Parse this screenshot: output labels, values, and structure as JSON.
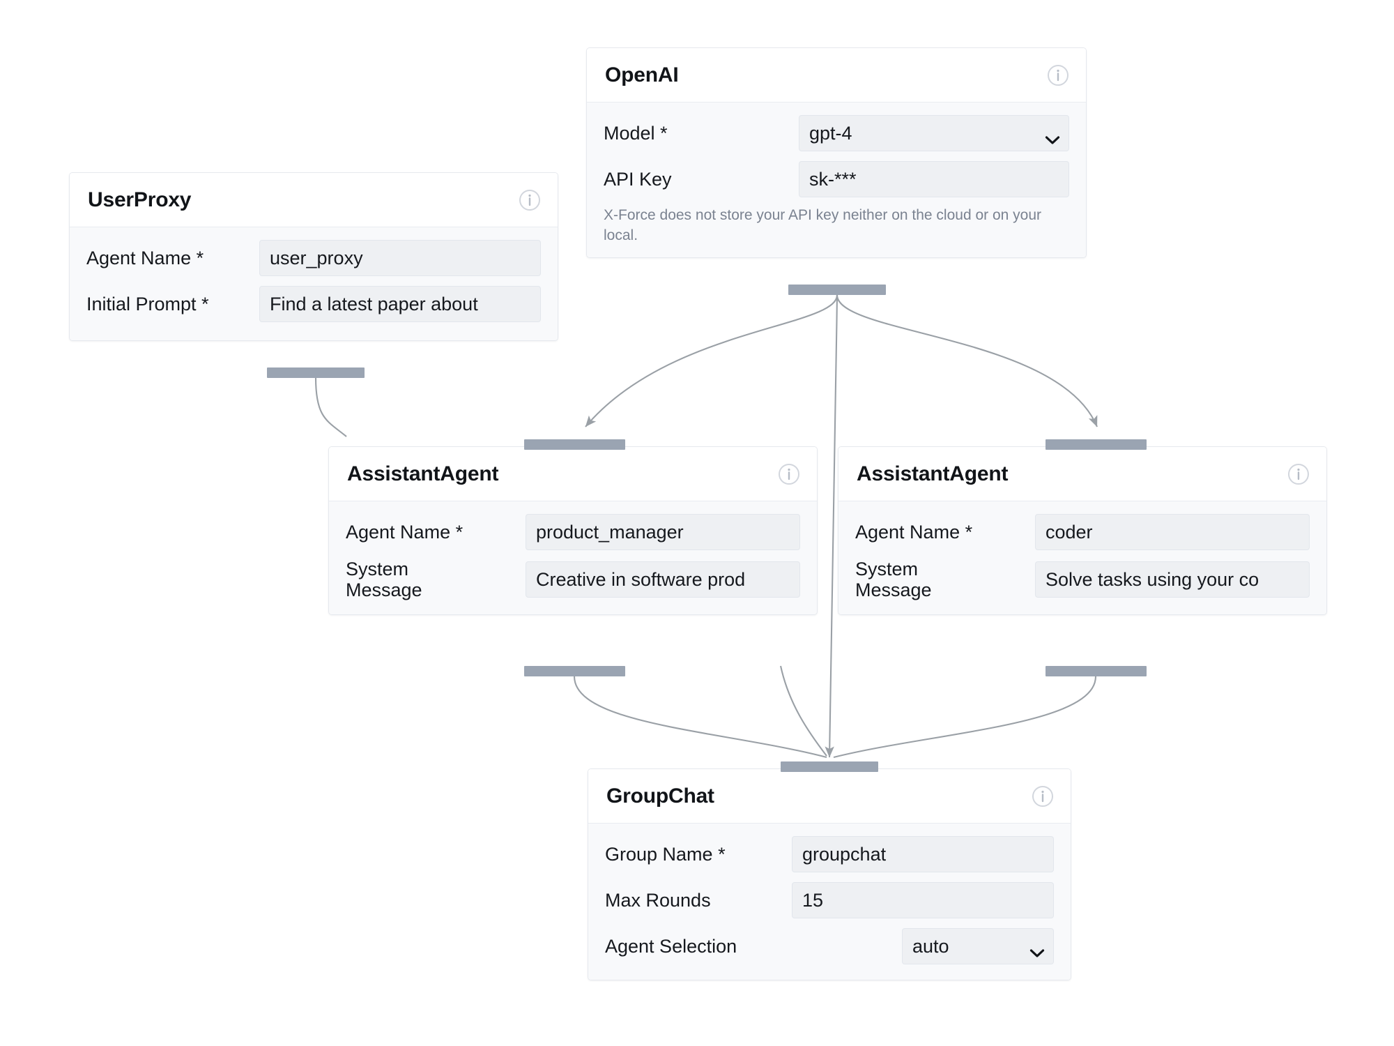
{
  "canvas": {
    "background": "#ffffff",
    "handle_color": "#9aa4b2",
    "edge_color": "#9aa0a6",
    "field_background": "#eef0f3",
    "node_body_background": "#f8f9fb",
    "node_border": "#e6e9ee"
  },
  "nodes": {
    "userproxy": {
      "title": "UserProxy",
      "info_icon": "info-circle-icon",
      "fields": [
        {
          "label": "Agent Name *",
          "value": "user_proxy",
          "type": "text"
        },
        {
          "label": "Initial Prompt *",
          "value": "Find a latest paper about",
          "type": "text"
        }
      ]
    },
    "openai": {
      "title": "OpenAI",
      "info_icon": "info-circle-icon",
      "fields": [
        {
          "label": "Model *",
          "value": "gpt-4",
          "type": "select"
        },
        {
          "label": "API Key",
          "value": "sk-***",
          "type": "text"
        }
      ],
      "hint": "X-Force does not store your API key neither on the cloud or on your local."
    },
    "assistant_1": {
      "title": "AssistantAgent",
      "info_icon": "info-circle-icon",
      "fields": [
        {
          "label": "Agent Name *",
          "value": "product_manager",
          "type": "text"
        },
        {
          "label": "System\nMessage",
          "value": "Creative in software prod",
          "type": "text"
        }
      ]
    },
    "assistant_2": {
      "title": "AssistantAgent",
      "info_icon": "info-circle-icon",
      "fields": [
        {
          "label": "Agent Name *",
          "value": "coder",
          "type": "text"
        },
        {
          "label": "System\nMessage",
          "value": "Solve tasks using your co",
          "type": "text"
        }
      ]
    },
    "groupchat": {
      "title": "GroupChat",
      "info_icon": "info-circle-icon",
      "fields": [
        {
          "label": "Group Name *",
          "value": "groupchat",
          "type": "text"
        },
        {
          "label": "Max Rounds",
          "value": "15",
          "type": "text"
        },
        {
          "label": "Agent Selection",
          "value": "auto",
          "type": "select"
        }
      ]
    }
  },
  "handles": {
    "userproxy_out": "source-handle-userproxy",
    "openai_out": "source-handle-openai",
    "assistant1_in": "target-handle-assistant-1",
    "assistant1_out": "source-handle-assistant-1",
    "assistant2_in": "target-handle-assistant-2",
    "assistant2_out": "source-handle-assistant-2",
    "groupchat_in": "target-handle-groupchat"
  },
  "edges": [
    {
      "id": "userproxy-to-assistant1",
      "from": "userproxy_out",
      "to": "assistant1_in"
    },
    {
      "id": "openai-to-assistant1",
      "from": "openai_out",
      "to": "assistant1_in"
    },
    {
      "id": "openai-to-assistant2",
      "from": "openai_out",
      "to": "assistant2_in"
    },
    {
      "id": "openai-to-groupchat",
      "from": "openai_out",
      "to": "groupchat_in"
    },
    {
      "id": "assistant1-to-groupchat",
      "from": "assistant1_out",
      "to": "groupchat_in"
    },
    {
      "id": "assistant2-to-groupchat",
      "from": "assistant2_out",
      "to": "groupchat_in"
    },
    {
      "id": "userproxy-to-groupchat",
      "from": "userproxy_out",
      "to": "groupchat_in"
    }
  ]
}
